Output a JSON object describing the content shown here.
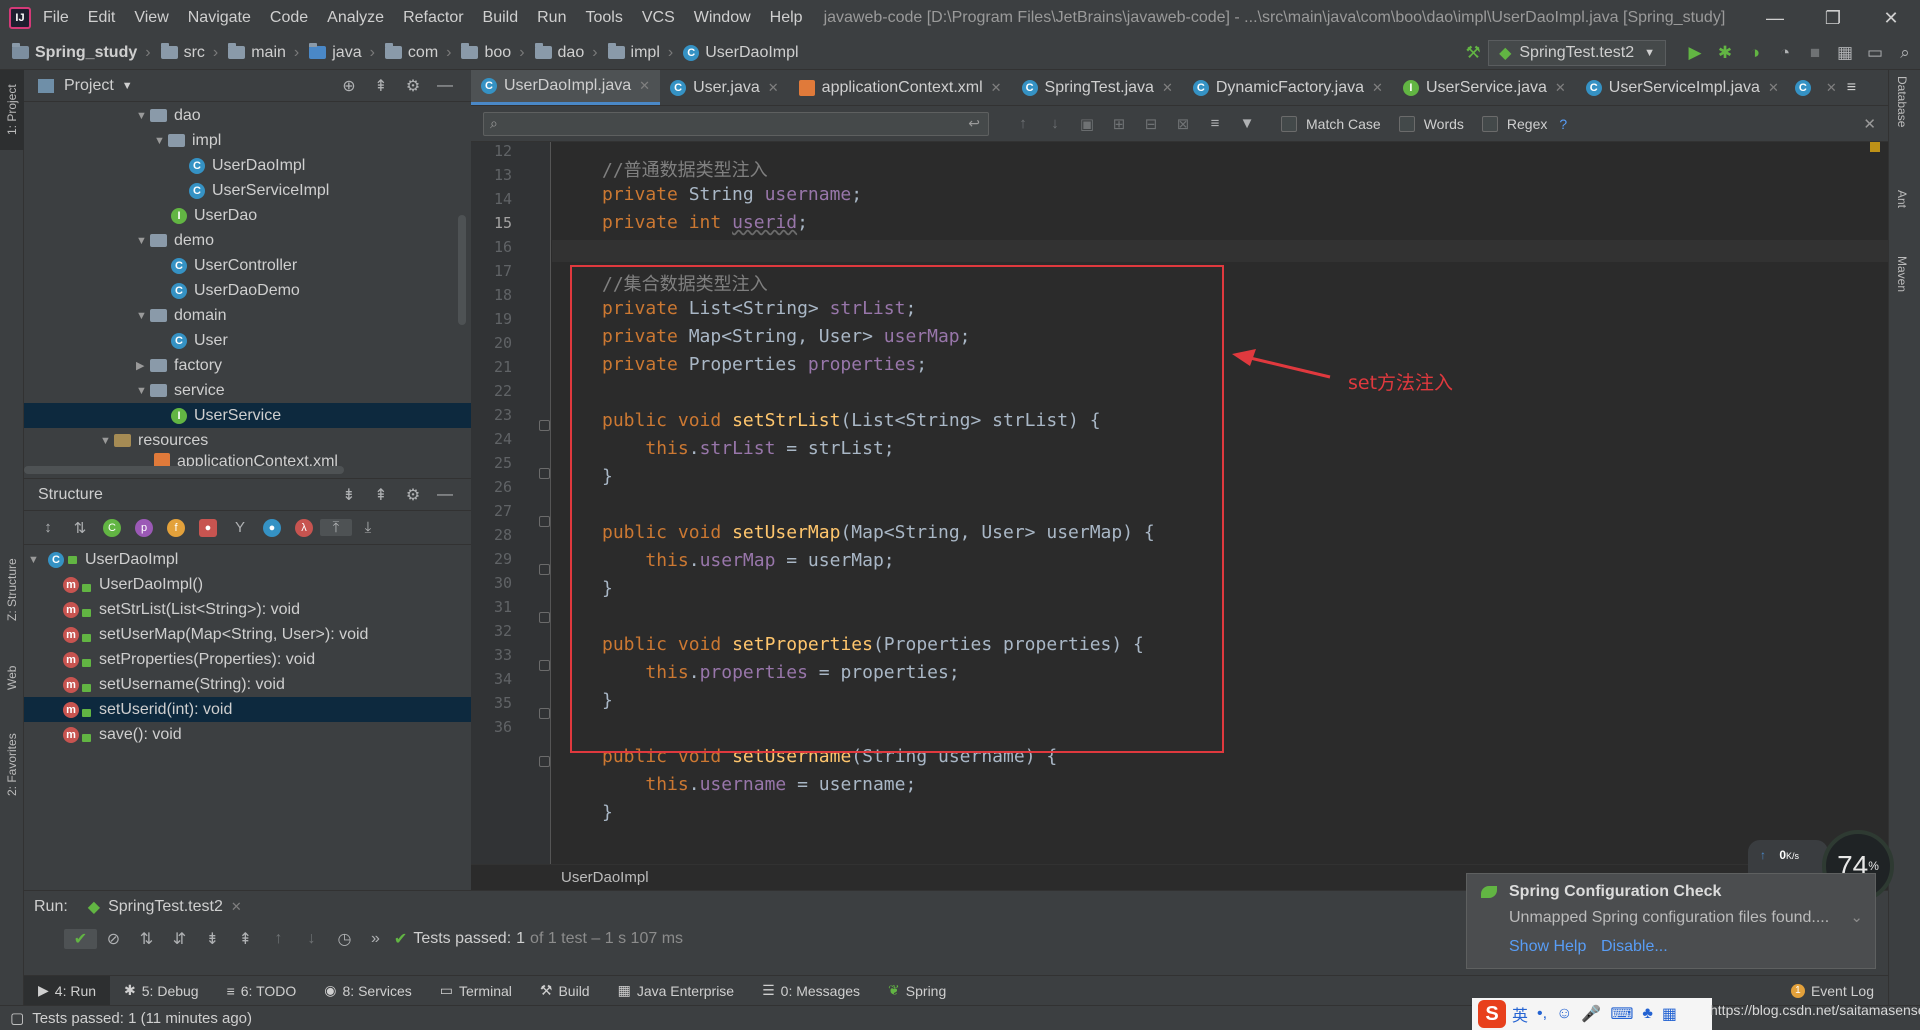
{
  "menubar": {
    "items": [
      "File",
      "Edit",
      "View",
      "Navigate",
      "Code",
      "Analyze",
      "Refactor",
      "Build",
      "Run",
      "Tools",
      "VCS",
      "Window",
      "Help"
    ],
    "window_title": "javaweb-code [D:\\Program Files\\JetBrains\\javaweb-code] - ...\\src\\main\\java\\com\\boo\\dao\\impl\\UserDaoImpl.java [Spring_study]"
  },
  "navbar": {
    "crumbs": [
      "Spring_study",
      "src",
      "main",
      "java",
      "com",
      "boo",
      "dao",
      "impl",
      "UserDaoImpl"
    ],
    "run_config": "SpringTest.test2"
  },
  "project_panel": {
    "title": "Project",
    "tree": [
      {
        "label": "dao",
        "type": "folder"
      },
      {
        "label": "impl",
        "type": "folder"
      },
      {
        "label": "UserDaoImpl",
        "type": "class"
      },
      {
        "label": "UserServiceImpl",
        "type": "class"
      },
      {
        "label": "UserDao",
        "type": "interface"
      },
      {
        "label": "demo",
        "type": "folder"
      },
      {
        "label": "UserController",
        "type": "class"
      },
      {
        "label": "UserDaoDemo",
        "type": "class"
      },
      {
        "label": "domain",
        "type": "folder"
      },
      {
        "label": "User",
        "type": "class"
      },
      {
        "label": "factory",
        "type": "folder"
      },
      {
        "label": "service",
        "type": "folder"
      },
      {
        "label": "UserService",
        "type": "interface"
      },
      {
        "label": "resources",
        "type": "folder"
      },
      {
        "label": "applicationContext.xml",
        "type": "xml"
      }
    ]
  },
  "structure_panel": {
    "title": "Structure",
    "root": "UserDaoImpl",
    "members": [
      "UserDaoImpl()",
      "setStrList(List<String>): void",
      "setUserMap(Map<String, User>): void",
      "setProperties(Properties): void",
      "setUsername(String): void",
      "setUserid(int): void",
      "save(): void"
    ]
  },
  "tabs": [
    "UserDaoImpl.java",
    "User.java",
    "applicationContext.xml",
    "SpringTest.java",
    "DynamicFactory.java",
    "UserService.java",
    "UserServiceImpl.java"
  ],
  "findbar": {
    "match_case": "Match Case",
    "words": "Words",
    "regex": "Regex",
    "help": "?"
  },
  "editor": {
    "line_numbers": [
      "12",
      "13",
      "14",
      "15",
      "16",
      "17",
      "18",
      "19",
      "20",
      "21",
      "22",
      "23",
      "24",
      "25",
      "26",
      "27",
      "28",
      "29",
      "30",
      "31",
      "32",
      "33",
      "34",
      "35",
      "36"
    ],
    "annotation": "set方法注入",
    "breadcrumb": "UserDaoImpl"
  },
  "run_panel": {
    "label": "Run:",
    "config": "SpringTest.test2",
    "result_prefix": "Tests passed:",
    "result_count": "1",
    "result_suffix": "of 1 test – 1 s 107 ms"
  },
  "notification": {
    "title": "Spring Configuration Check",
    "body": "Unmapped Spring configuration files found....",
    "link1": "Show Help",
    "link2": "Disable..."
  },
  "speed_widget": {
    "up": "0",
    "down": "0",
    "unit": "K/s",
    "cpu": "74",
    "cpu_unit": "%"
  },
  "bottom_tabs": [
    "4: Run",
    "5: Debug",
    "6: TODO",
    "8: Services",
    "Terminal",
    "Build",
    "Java Enterprise",
    "0: Messages",
    "Spring"
  ],
  "event_log": "Event Log",
  "statusbar": {
    "message": "Tests passed: 1 (11 minutes ago)"
  },
  "ime": {
    "lang": "英"
  },
  "watermark": "https://blog.csdn.net/saitamasensei",
  "left_stripe": [
    "1: Project",
    "Z: Structure",
    "Web",
    "2: Favorites"
  ],
  "right_stripe": [
    "Database",
    "Ant",
    "Maven"
  ]
}
